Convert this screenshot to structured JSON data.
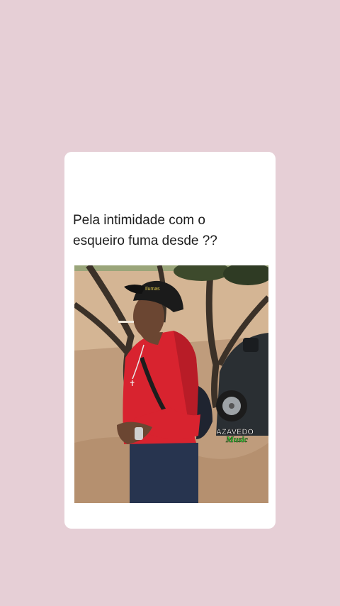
{
  "post": {
    "caption": "  Pela intimidade com o\nesqueiro fuma desde ??"
  },
  "photo": {
    "cap_text": "Ilumas",
    "watermark_line1": "AZAVEDO",
    "watermark_line2": "Music"
  }
}
